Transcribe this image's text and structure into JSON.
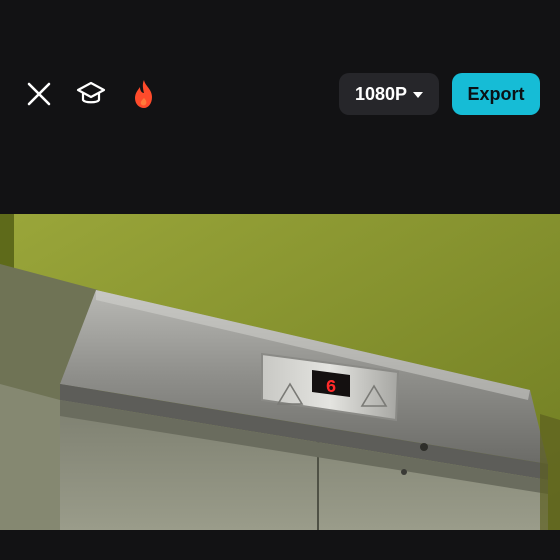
{
  "toolbar": {
    "close_icon": "close-icon",
    "tutorial_icon": "graduation-cap-icon",
    "trending_icon": "fire-icon",
    "resolution_label": "1080P",
    "resolution_icon": "caret-down-icon",
    "export_label": "Export"
  },
  "preview": {
    "floor_indicator": "6",
    "scene": "elevator-doors-with-floor-display"
  },
  "colors": {
    "background": "#121214",
    "accent": "#16bcd6",
    "fire": "#ff4b2b",
    "display_red": "#ff2a2a"
  }
}
